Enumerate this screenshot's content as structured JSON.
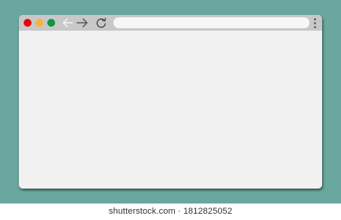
{
  "browser": {
    "window_controls": [
      {
        "name": "close",
        "color": "#e8000b"
      },
      {
        "name": "minimize",
        "color": "#f4b53f"
      },
      {
        "name": "maximize",
        "color": "#12963e"
      }
    ],
    "navigation": {
      "back_icon": "arrow-left-icon",
      "forward_icon": "arrow-right-icon",
      "reload_icon": "reload-icon"
    },
    "address_bar": {
      "value": "",
      "placeholder": ""
    },
    "menu_icon": "kebab-menu-icon",
    "toolbar_color": "#c8c8c8",
    "content_color": "#f1f1f1"
  },
  "background_color": "#6aa79e",
  "watermark": {
    "text": "shutterstock.com · 1812825052"
  }
}
